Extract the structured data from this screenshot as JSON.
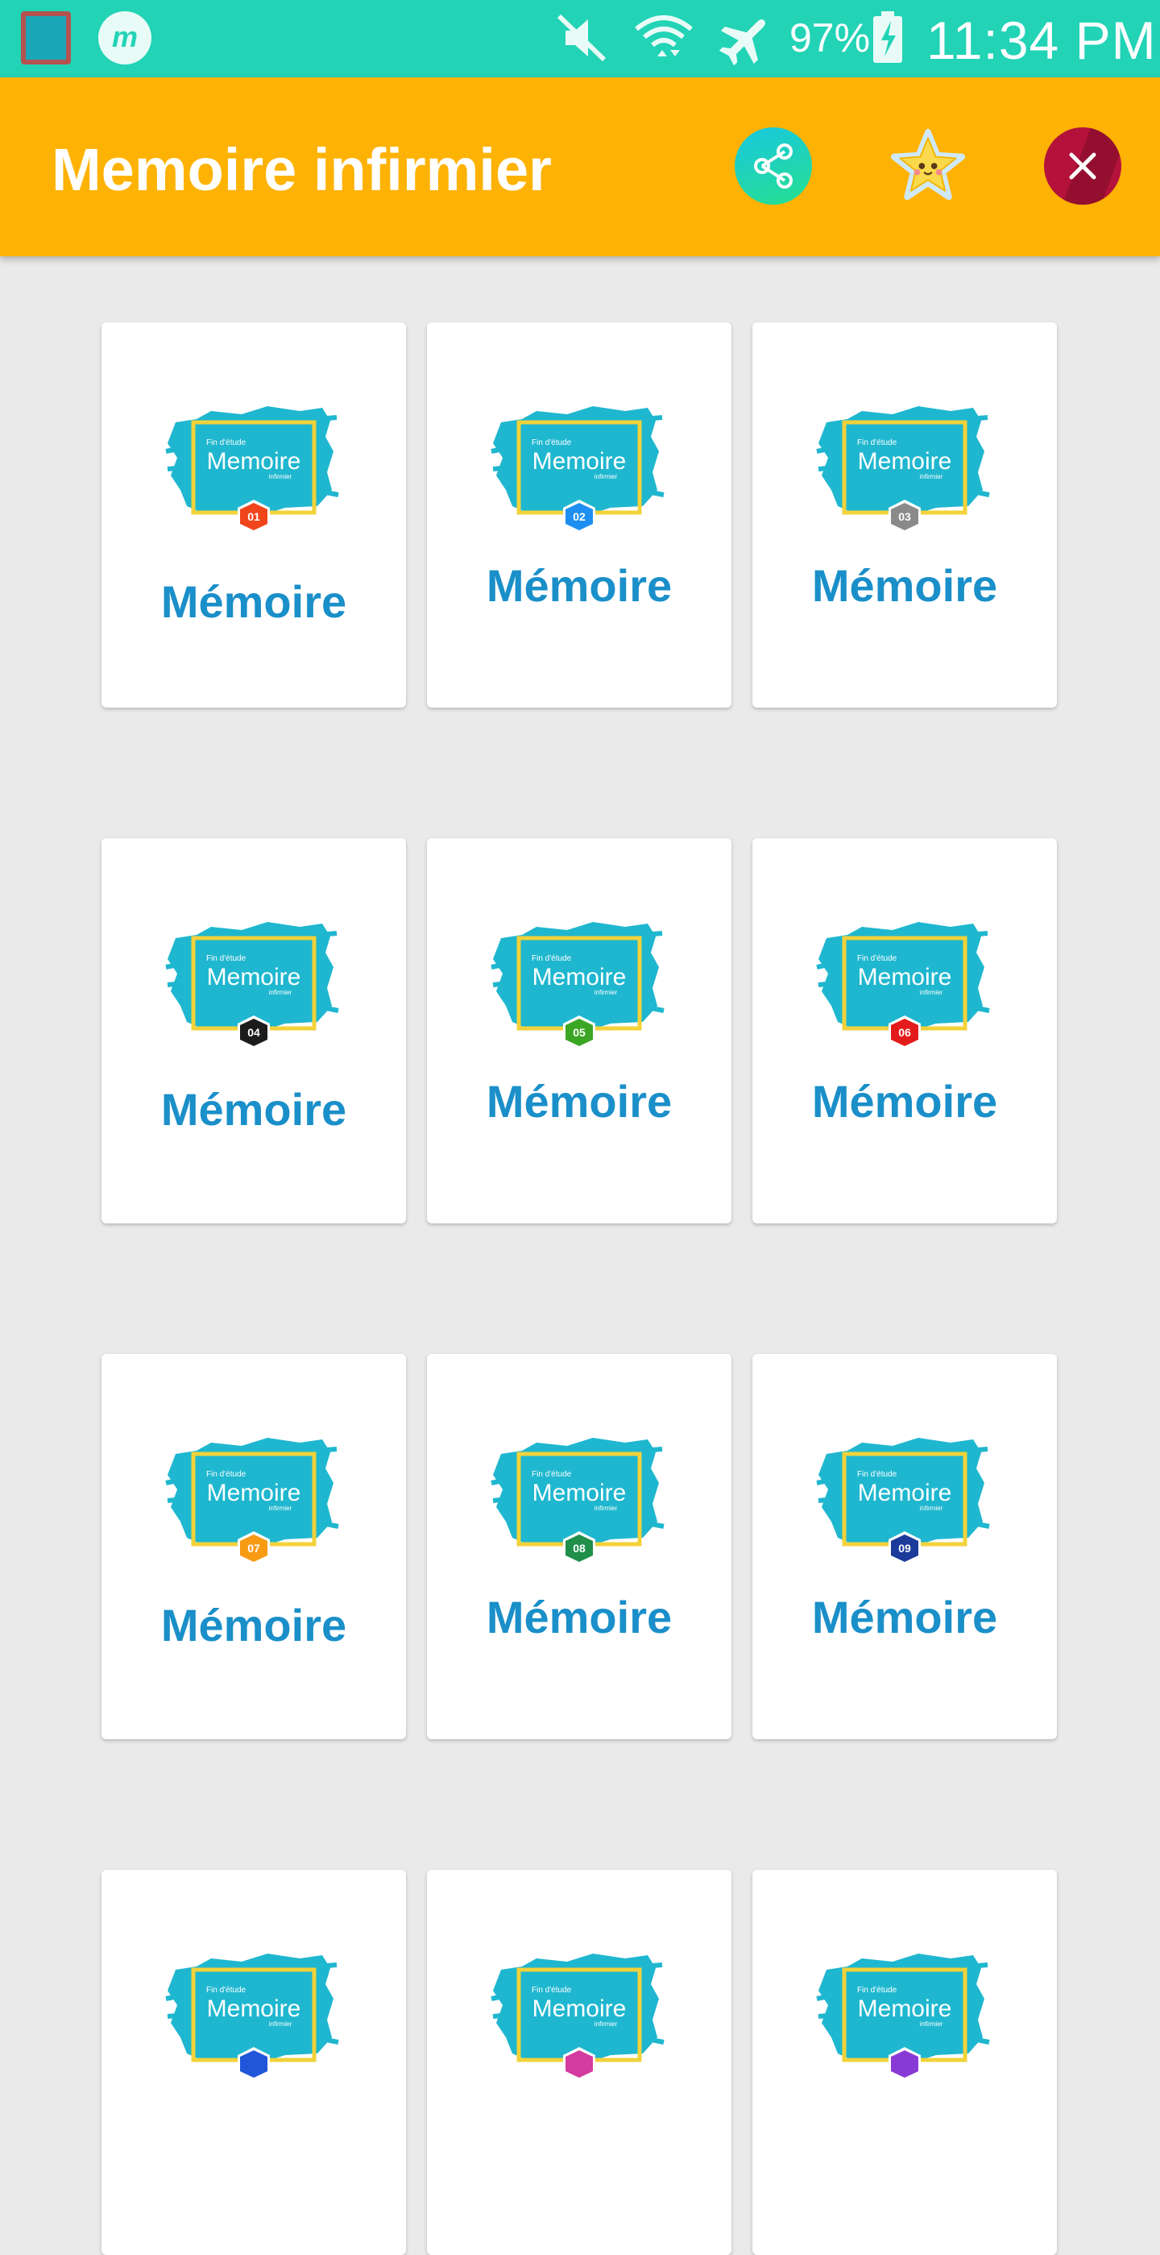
{
  "status_bar": {
    "battery_percent": "97%",
    "time": "11:34 PM",
    "icons": [
      "app-thumbnail-icon",
      "messenger-m-icon",
      "mute-icon",
      "wifi-icon",
      "airplane-mode-icon",
      "battery-charging-icon"
    ]
  },
  "app_bar": {
    "title": "Memoire infirmier",
    "buttons": [
      "share-icon",
      "star-icon",
      "close-icon"
    ],
    "colors": {
      "bar": "#feb204",
      "share": "#18c7e0",
      "close": "#b4123a"
    }
  },
  "thumb_text": {
    "top": "Fin d'étude",
    "main": "Memoire",
    "sub": "infirmier"
  },
  "items": [
    {
      "label": "Mémoire",
      "number": "01",
      "badge_color": "#f0451b"
    },
    {
      "label": "Mémoire",
      "number": "02",
      "badge_color": "#1e8ff0"
    },
    {
      "label": "Mémoire",
      "number": "03",
      "badge_color": "#8a8a8a"
    },
    {
      "label": "Mémoire",
      "number": "04",
      "badge_color": "#1c1c1c"
    },
    {
      "label": "Mémoire",
      "number": "05",
      "badge_color": "#3aa624"
    },
    {
      "label": "Mémoire",
      "number": "06",
      "badge_color": "#e41b1b"
    },
    {
      "label": "Mémoire",
      "number": "07",
      "badge_color": "#f79a14"
    },
    {
      "label": "Mémoire",
      "number": "08",
      "badge_color": "#1f8f4a"
    },
    {
      "label": "Mémoire",
      "number": "09",
      "badge_color": "#1b3a9a"
    },
    {
      "number": "",
      "badge_color": "#2156d8"
    },
    {
      "number": "",
      "badge_color": "#d43aa0"
    },
    {
      "number": "",
      "badge_color": "#8a3ad4"
    }
  ]
}
